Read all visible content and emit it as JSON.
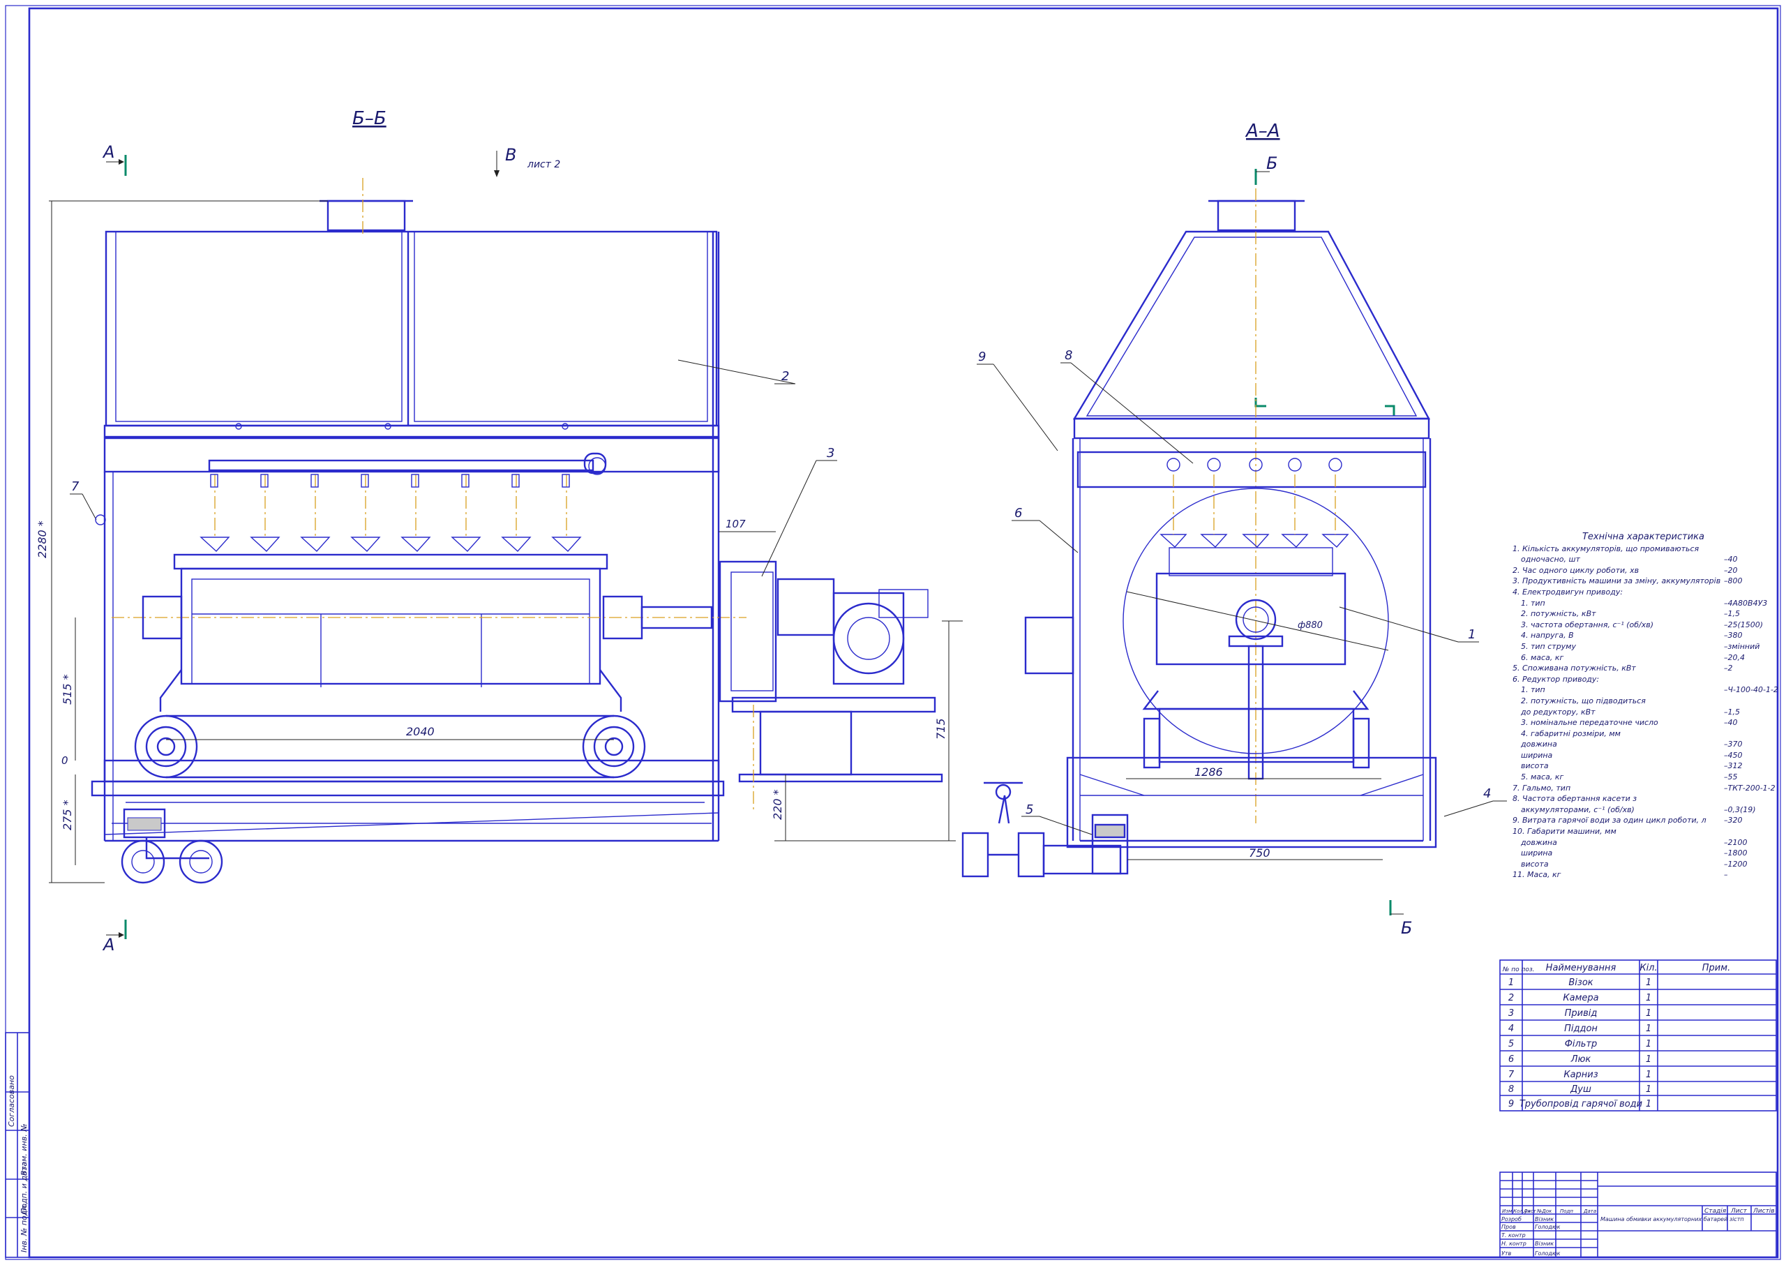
{
  "views": {
    "section_b": "Б–Б",
    "section_a": "А–А",
    "cut_a_top": "А",
    "cut_a_bottom": "А",
    "cut_b_top": "Б",
    "cut_b_bottom": "Б",
    "view_v": "В",
    "view_v_ref": "лист 2"
  },
  "callouts": [
    "1",
    "2",
    "3",
    "4",
    "5",
    "6",
    "7",
    "8",
    "9"
  ],
  "dimensions": {
    "overall_height": "2280 *",
    "d515": "515 *",
    "d0": "0",
    "d275": "275 *",
    "d2040": "2040",
    "d107": "107",
    "d715": "715",
    "d220": "220 *",
    "d1286": "1286",
    "d750": "750",
    "diam": "ф880"
  },
  "tech": {
    "title": "Технічна характеристика",
    "rows": [
      {
        "label": "1. Кількість аккумуляторів, що промиваються",
        "value": ""
      },
      {
        "label": "одночасно, шт",
        "value": "–40"
      },
      {
        "label": "2. Час одного циклу роботи, хв",
        "value": "–20"
      },
      {
        "label": "3. Продуктивність машини за зміну, аккумуляторів",
        "value": "–800"
      },
      {
        "label": "4. Електродвигун приводу:",
        "value": ""
      },
      {
        "label": "1. тип",
        "value": "–4А80В4У3"
      },
      {
        "label": "2. потужність, кВт",
        "value": "–1,5"
      },
      {
        "label": "3. частота обертання, с⁻¹ (об/хв)",
        "value": "–25(1500)"
      },
      {
        "label": "4. напруга, В",
        "value": "–380"
      },
      {
        "label": "5. тип струму",
        "value": "–змінний"
      },
      {
        "label": "6. маса, кг",
        "value": "–20,4"
      },
      {
        "label": "5. Споживана потужність, кВт",
        "value": "–2"
      },
      {
        "label": "6. Редуктор приводу:",
        "value": ""
      },
      {
        "label": "1. тип",
        "value": "–Ч-100-40-1-2"
      },
      {
        "label": "2. потужність, що підводиться",
        "value": ""
      },
      {
        "label": "до редуктору, кВт",
        "value": "–1,5"
      },
      {
        "label": "3. номінальне передаточне число",
        "value": "–40"
      },
      {
        "label": "4. габаритні розміри, мм",
        "value": ""
      },
      {
        "label": "довжина",
        "value": "–370"
      },
      {
        "label": "ширина",
        "value": "–450"
      },
      {
        "label": "висота",
        "value": "–312"
      },
      {
        "label": "5. маса, кг",
        "value": "–55"
      },
      {
        "label": "7. Гальмо, тип",
        "value": "–ТКТ-200-1-2"
      },
      {
        "label": "8. Частота обертання касети з",
        "value": ""
      },
      {
        "label": "аккумуляторами, с⁻¹ (об/хв)",
        "value": "–0,3(19)"
      },
      {
        "label": "9. Витрата гарячої води за один цикл роботи, л",
        "value": "–320"
      },
      {
        "label": "10. Габарити машини, мм",
        "value": ""
      },
      {
        "label": "довжина",
        "value": "–2100"
      },
      {
        "label": "ширина",
        "value": "–1800"
      },
      {
        "label": "висота",
        "value": "–1200"
      },
      {
        "label": "11. Маса, кг",
        "value": "–"
      }
    ]
  },
  "parts": {
    "headers": {
      "pos": "№ по поз.",
      "name": "Найменування",
      "qty": "Кіл.",
      "note": "Прим."
    },
    "rows": [
      {
        "pos": "1",
        "name": "Візок",
        "qty": "1"
      },
      {
        "pos": "2",
        "name": "Камера",
        "qty": "1"
      },
      {
        "pos": "3",
        "name": "Привід",
        "qty": "1"
      },
      {
        "pos": "4",
        "name": "Піддон",
        "qty": "1"
      },
      {
        "pos": "5",
        "name": "Фільтр",
        "qty": "1"
      },
      {
        "pos": "6",
        "name": "Люк",
        "qty": "1"
      },
      {
        "pos": "7",
        "name": "Карниз",
        "qty": "1"
      },
      {
        "pos": "8",
        "name": "Душ",
        "qty": "1"
      },
      {
        "pos": "9",
        "name": "Трубопровід гарячої води",
        "qty": "1"
      }
    ]
  },
  "title_block": {
    "drawing_name": "Машина обмивки аккумуляторних батарей зістп",
    "stage": "Стадія",
    "sheet": "Лист",
    "sheets": "Листів",
    "col_headers": [
      "Изм",
      "Кол.уч",
      "Лист",
      "№Док",
      "Подп",
      "Дата"
    ],
    "roles": [
      "Розроб",
      "Пров",
      "Т. контр",
      "Н. контр",
      "Утв"
    ],
    "names": [
      "Візник",
      "Голодюк",
      "",
      "Візник",
      "Голодюк"
    ]
  },
  "side_stamp": [
    "Інв. № подл.",
    "Подп. и дата",
    "Взам. инв. №",
    "Согласовано"
  ]
}
